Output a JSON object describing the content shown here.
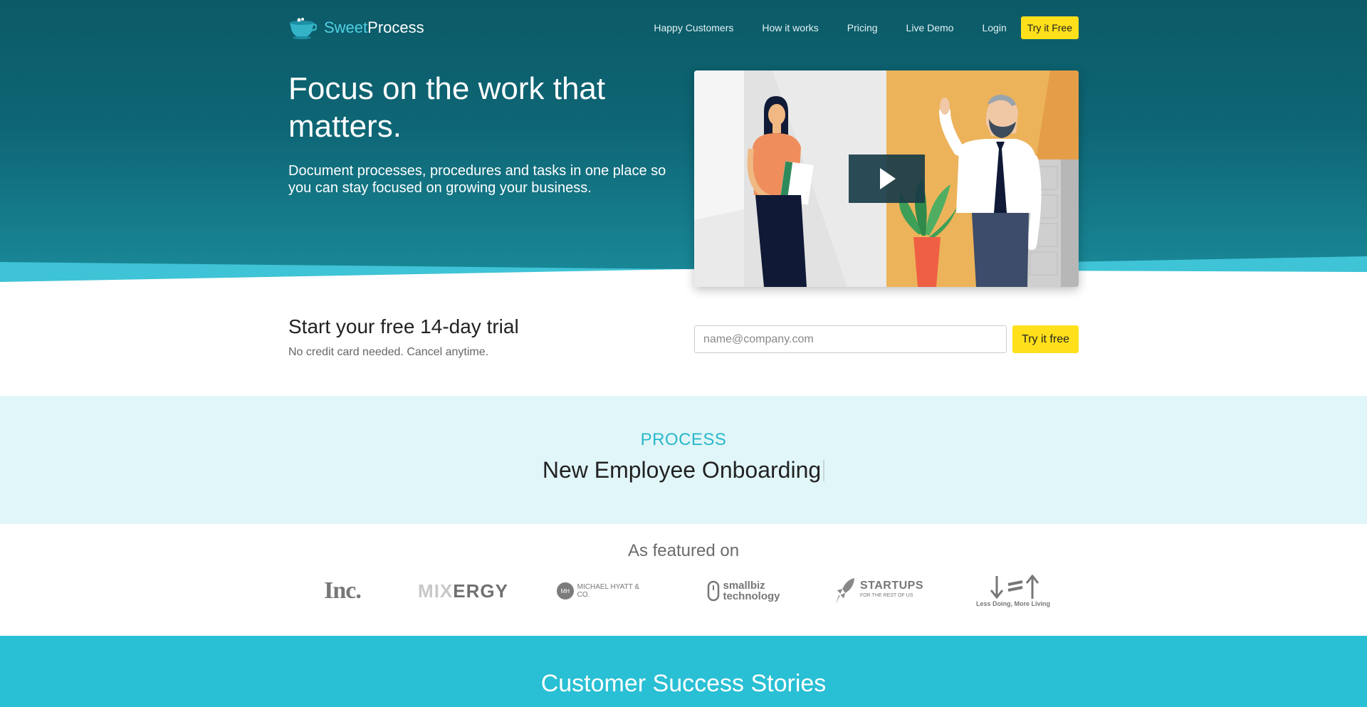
{
  "brand": {
    "name_part1": "Sweet",
    "name_part2": "Process"
  },
  "nav": {
    "links": [
      "Happy Customers",
      "How it works",
      "Pricing",
      "Live Demo",
      "Login"
    ],
    "cta": "Try it Free"
  },
  "hero": {
    "title": "Focus on the work that matters.",
    "subtitle": "Document processes, procedures and tasks in one place so you can stay focused on growing your business."
  },
  "trial": {
    "title": "Start your free 14-day trial",
    "subtitle": "No credit card needed. Cancel anytime.",
    "email_placeholder": "name@company.com",
    "button": "Try it free"
  },
  "process": {
    "label": "PROCESS",
    "name": "New Employee Onboarding"
  },
  "featured": {
    "title": "As featured on",
    "logos": {
      "inc": "Inc.",
      "mixergy_a": "MIX",
      "mixergy_b": "ERGY",
      "hyatt": "MICHAEL HYATT & CO.",
      "hyatt_mono": "MH",
      "smallbiz_1": "smallbiz",
      "smallbiz_2": "technology",
      "startups_1": "STARTUPS",
      "startups_2": "FOR THE REST OF US",
      "less_doing": "Less Doing, More Living"
    }
  },
  "success": {
    "title": "Customer Success Stories"
  },
  "colors": {
    "hero_dark": "#0c5a67",
    "accent": "#29bfd4",
    "cta_yellow": "#ffe01b",
    "process_bg": "#e1f6f8"
  }
}
